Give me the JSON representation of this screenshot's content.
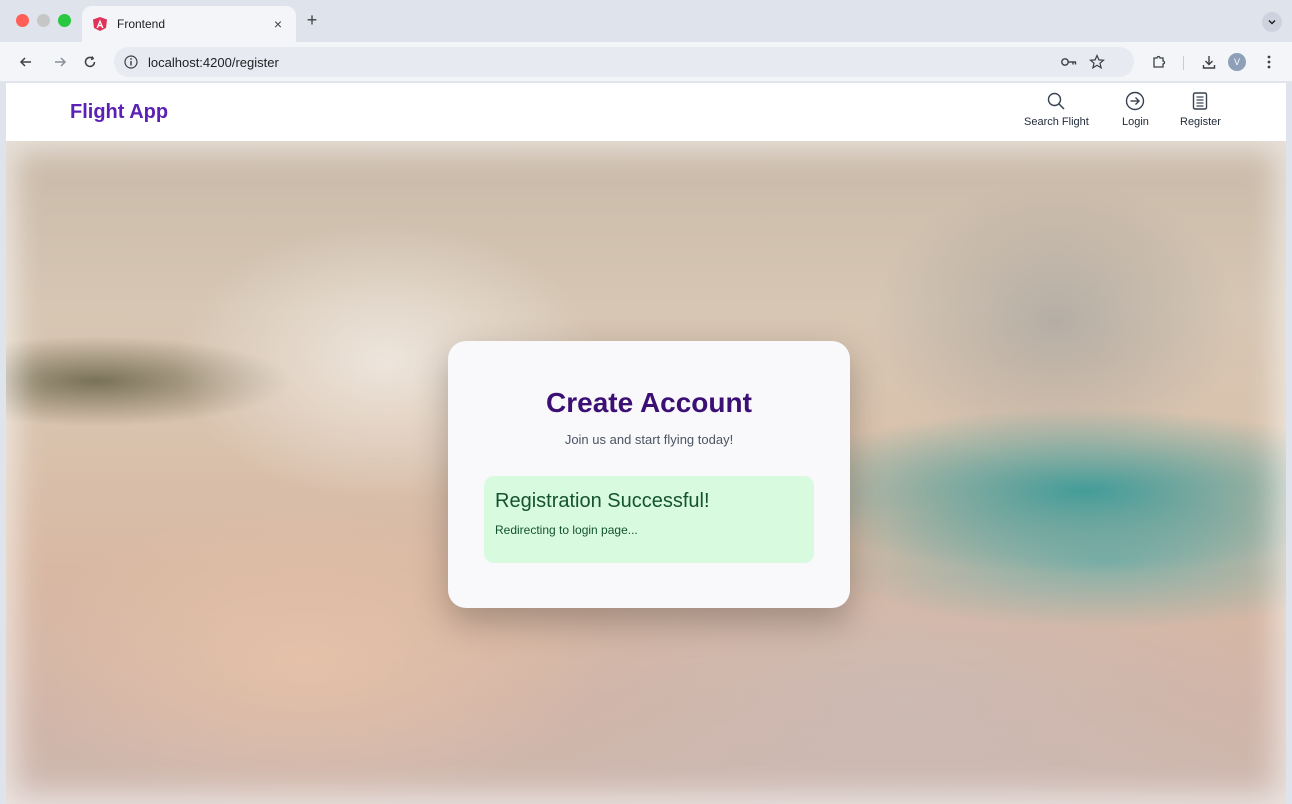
{
  "browser": {
    "tab_title": "Frontend",
    "tab_close": "×",
    "new_tab": "+",
    "url": "localhost:4200/register",
    "profile_initial": "V"
  },
  "header": {
    "brand": "Flight App",
    "nav": [
      {
        "label": "Search Flight",
        "icon": "search-icon"
      },
      {
        "label": "Login",
        "icon": "login-icon"
      },
      {
        "label": "Register",
        "icon": "register-icon"
      }
    ]
  },
  "card": {
    "title": "Create Account",
    "subtitle": "Join us and start flying today!",
    "success_title": "Registration Successful!",
    "success_message": "Redirecting to login page..."
  },
  "colors": {
    "brand": "#5b21b6",
    "title": "#3b0f73",
    "success_bg": "#d8fadf",
    "success_text": "#14532d"
  }
}
